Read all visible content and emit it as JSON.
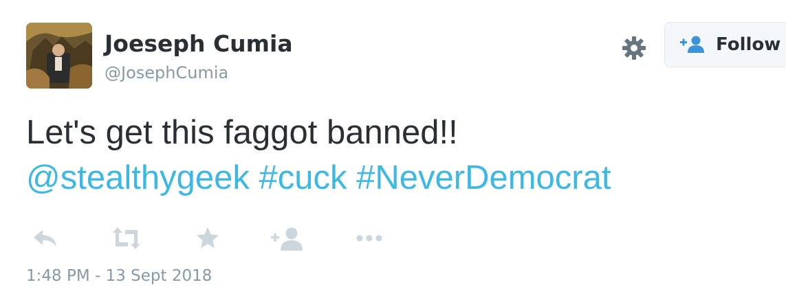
{
  "user": {
    "display_name": "Joeseph Cumia",
    "handle": "@JosephCumia"
  },
  "header": {
    "settings_icon": "gear-icon",
    "follow_label": "Follow",
    "follow_icon": "add-user-icon"
  },
  "tweet": {
    "text": "Let's get this faggot banned!!",
    "mention": "@stealthygeek",
    "hashtags": [
      "#cuck",
      "#NeverDemocrat"
    ],
    "timestamp": "1:48 PM - 13 Sept 2018"
  },
  "actions": [
    "reply-icon",
    "retweet-icon",
    "favorite-star-icon",
    "add-user-icon",
    "more-dots-icon"
  ],
  "colors": {
    "text": "#292f33",
    "muted": "#8899a6",
    "link": "#3bb8e4",
    "action_icon": "#ccd6dd",
    "follow_accent": "#3b94d9"
  }
}
